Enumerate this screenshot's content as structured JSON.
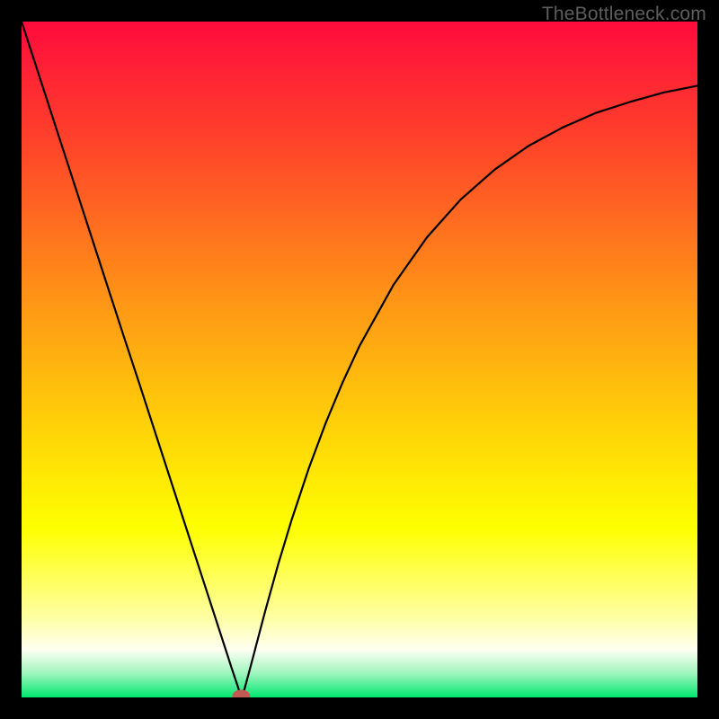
{
  "watermark": "TheBottleneck.com",
  "chart_data": {
    "type": "line",
    "title": "",
    "xlabel": "",
    "ylabel": "",
    "xlim": [
      0,
      100
    ],
    "ylim": [
      0,
      100
    ],
    "grid": false,
    "legend": false,
    "background_gradient": {
      "stops": [
        {
          "offset": 0.0,
          "color": "#ff0b3c"
        },
        {
          "offset": 0.2,
          "color": "#ff4a28"
        },
        {
          "offset": 0.4,
          "color": "#ff9117"
        },
        {
          "offset": 0.6,
          "color": "#ffd208"
        },
        {
          "offset": 0.75,
          "color": "#feff00"
        },
        {
          "offset": 0.88,
          "color": "#feffa0"
        },
        {
          "offset": 0.93,
          "color": "#fefff2"
        },
        {
          "offset": 0.965,
          "color": "#9cf5bc"
        },
        {
          "offset": 1.0,
          "color": "#00e76f"
        }
      ]
    },
    "series": [
      {
        "name": "bottleneck-curve",
        "x": [
          0.0,
          2.5,
          5.0,
          7.5,
          10.0,
          12.5,
          15.0,
          17.5,
          20.0,
          22.5,
          25.0,
          27.5,
          30.0,
          31.0,
          32.0,
          32.5,
          33.0,
          34.0,
          36.0,
          38.0,
          40.0,
          42.5,
          45.0,
          47.5,
          50.0,
          55.0,
          60.0,
          65.0,
          70.0,
          75.0,
          80.0,
          85.0,
          90.0,
          95.0,
          100.0
        ],
        "y": [
          100.0,
          92.3,
          84.6,
          76.9,
          69.2,
          61.5,
          53.8,
          46.2,
          38.5,
          30.8,
          23.1,
          15.4,
          7.7,
          4.6,
          1.6,
          0.0,
          1.3,
          5.0,
          12.6,
          19.8,
          26.4,
          33.9,
          40.6,
          46.6,
          52.0,
          61.0,
          68.1,
          73.7,
          78.1,
          81.6,
          84.3,
          86.5,
          88.1,
          89.5,
          90.5
        ]
      }
    ],
    "marker": {
      "x": 32.5,
      "y": 0.2,
      "color": "#c05a53",
      "label": ""
    }
  }
}
